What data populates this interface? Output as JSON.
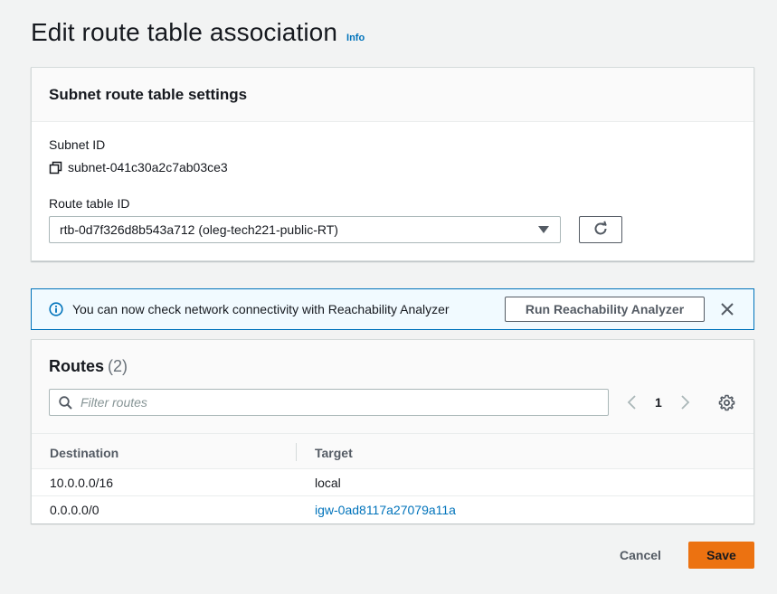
{
  "page": {
    "title": "Edit route table association",
    "info_link": "Info"
  },
  "settings": {
    "title": "Subnet route table settings",
    "subnet_label": "Subnet ID",
    "subnet_value": "subnet-041c30a2c7ab03ce3",
    "route_table_label": "Route table ID",
    "route_table_value": "rtb-0d7f326d8b543a712 (oleg-tech221-public-RT)"
  },
  "flash": {
    "message": "You can now check network connectivity with Reachability Analyzer",
    "button_label": "Run Reachability Analyzer"
  },
  "routes": {
    "title": "Routes",
    "count": "(2)",
    "filter_placeholder": "Filter routes",
    "current_page": "1",
    "columns": [
      "Destination",
      "Target"
    ],
    "rows": [
      {
        "destination": "10.0.0.0/16",
        "target": "local"
      },
      {
        "destination": "0.0.0.0/0",
        "target": "igw-0ad8117a27079a11a"
      }
    ]
  },
  "actions": {
    "cancel_label": "Cancel",
    "save_label": "Save"
  },
  "colors": {
    "accent": "#ec7211",
    "link": "#0073bb",
    "background": "#f2f3f3",
    "flash_bg": "#f1faff"
  },
  "icons": [
    "copy-icon",
    "caret-down-icon",
    "refresh-icon",
    "info-circle-icon",
    "close-icon",
    "search-icon",
    "chevron-left-icon",
    "chevron-right-icon",
    "gear-icon"
  ]
}
